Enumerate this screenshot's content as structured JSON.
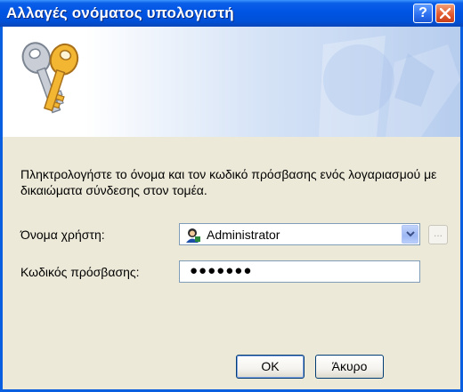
{
  "window": {
    "title": "Αλλαγές ονόματος υπολογιστή",
    "help_glyph": "?"
  },
  "banner": {
    "icon": "keys-icon"
  },
  "form": {
    "description": "Πληκτρολογήστε το όνομα και τον κωδικό πρόσβασης ενός λογαριασμού με δικαιώματα σύνδεσης στον τομέα.",
    "username_label": "Όνομα χρήστη:",
    "username_value": "Administrator",
    "password_label": "Κωδικός πρόσβασης:",
    "password_value": "●●●●●●●",
    "browse_label": "..."
  },
  "buttons": {
    "ok": "OK",
    "cancel": "Άκυρο"
  },
  "colors": {
    "titlebar": "#0054e3",
    "dialog_bg": "#ece9d8",
    "input_border": "#7f9db9",
    "close_button": "#e35b2f"
  }
}
